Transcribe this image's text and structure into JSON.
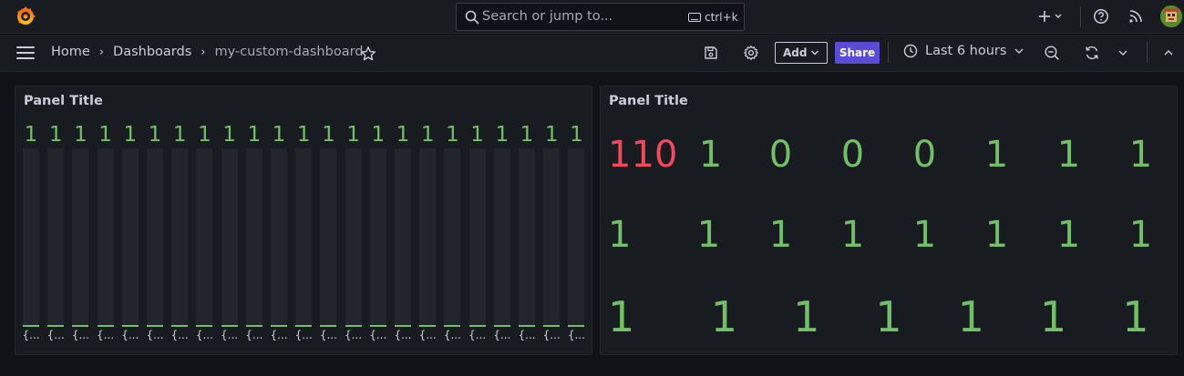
{
  "topbar": {
    "search_placeholder": "Search or jump to...",
    "search_shortcut": "ctrl+k",
    "icons": [
      "grafana-logo-icon",
      "search-icon",
      "keyboard-icon",
      "plus-icon",
      "chevron-down-icon",
      "help-icon",
      "rss-icon",
      "avatar"
    ]
  },
  "breadcrumb": {
    "home": "Home",
    "dashboards": "Dashboards",
    "current": "my-custom-dashboard"
  },
  "toolbar": {
    "add_label": "Add",
    "share_label": "Share",
    "time_range": "Last 6 hours"
  },
  "colors": {
    "accent": "#5b4cd8",
    "green": "#73bf69",
    "red": "#f2495c",
    "background": "#111217",
    "panel": "#181b1f"
  },
  "panels": [
    {
      "title": "Panel Title",
      "type": "bar-gauge",
      "values": [
        "1",
        "1",
        "1",
        "1",
        "1",
        "1",
        "1",
        "1",
        "1",
        "1",
        "1",
        "1",
        "1",
        "1",
        "1",
        "1",
        "1",
        "1",
        "1",
        "1",
        "1",
        "1",
        "1"
      ],
      "labels": [
        "{...",
        "{...",
        "{...",
        "{...",
        "{...",
        "{...",
        "{...",
        "{...",
        "{...",
        "{...",
        "{...",
        "{...",
        "{...",
        "{...",
        "{...",
        "{...",
        "{...",
        "{...",
        "{...",
        "{...",
        "{...",
        "{...",
        "{..."
      ]
    },
    {
      "title": "Panel Title",
      "type": "stat",
      "rows": [
        [
          {
            "v": "110",
            "color": "red"
          },
          {
            "v": "1"
          },
          {
            "v": "0"
          },
          {
            "v": "0"
          },
          {
            "v": "0"
          },
          {
            "v": "1"
          },
          {
            "v": "1"
          },
          {
            "v": "1"
          }
        ],
        [
          {
            "v": "1"
          },
          {
            "v": "1"
          },
          {
            "v": "1"
          },
          {
            "v": "1"
          },
          {
            "v": "1"
          },
          {
            "v": "1"
          },
          {
            "v": "1"
          },
          {
            "v": "1"
          }
        ],
        [
          {
            "v": "1"
          },
          {
            "v": "1"
          },
          {
            "v": "1"
          },
          {
            "v": "1"
          },
          {
            "v": "1"
          },
          {
            "v": "1"
          },
          {
            "v": "1"
          }
        ]
      ]
    }
  ]
}
